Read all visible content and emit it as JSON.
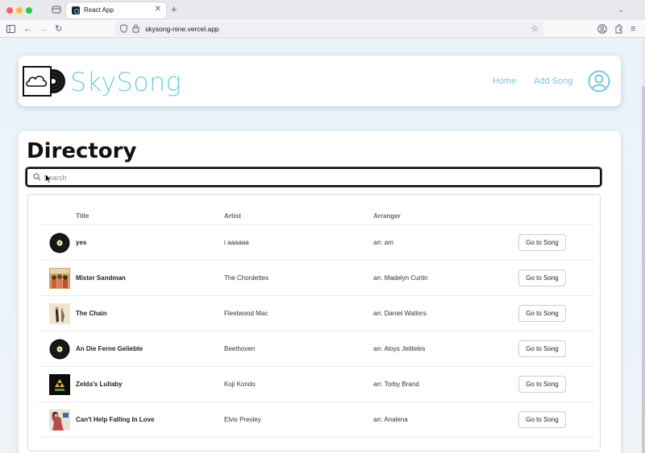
{
  "browser": {
    "tab_title": "React App",
    "url": "skysong-nine.vercel.app"
  },
  "header": {
    "brand": "SkySong",
    "nav": {
      "home": "Home",
      "add_song": "Add Song"
    }
  },
  "directory": {
    "title": "Directory",
    "search_placeholder": "Search",
    "columns": {
      "title": "Title",
      "artist": "Artist",
      "arranger": "Arranger"
    },
    "go_label": "Go to Song",
    "songs": [
      {
        "title": "yes",
        "artist": "i aaaaaa",
        "arranger": "arr. am",
        "thumb": "vinyl-icon"
      },
      {
        "title": "Mister Sandman",
        "artist": "The Chordettes",
        "arranger": "arr. Madelyn Curtin",
        "thumb": "album-cover"
      },
      {
        "title": "The Chain",
        "artist": "Fleetwood Mac",
        "arranger": "arr. Daniel Watters",
        "thumb": "album-cover"
      },
      {
        "title": "An Die Ferne Geliebte",
        "artist": "Beethoven",
        "arranger": "arr. Aloys Jeitteles",
        "thumb": "vinyl-icon"
      },
      {
        "title": "Zelda's Lullaby",
        "artist": "Koji Kondo",
        "arranger": "arr. Torby Brand",
        "thumb": "album-cover"
      },
      {
        "title": "Can't Help Falling In Love",
        "artist": "Elvis Presley",
        "arranger": "arr. Analena",
        "thumb": "album-cover"
      }
    ]
  },
  "colors": {
    "brand": "#6fd0ea",
    "nav_link": "#7ac7e3"
  }
}
